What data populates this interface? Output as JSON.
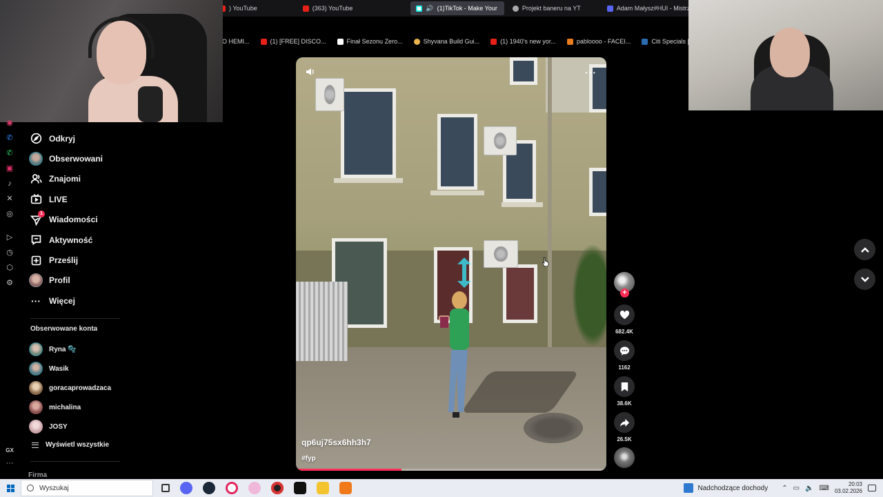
{
  "browser": {
    "tabs": [
      {
        "label": ") YouTube",
        "icon": "youtube-icon",
        "active": false
      },
      {
        "label": "(363) YouTube",
        "icon": "youtube-icon",
        "active": false
      },
      {
        "label": "(1)TikTok - Make Your",
        "icon": "tiktok-icon",
        "active": true
      },
      {
        "label": "Projekt baneru na YT",
        "icon": "globe-icon",
        "active": false
      },
      {
        "label": "Adam Małysz#HUI - Mistrz",
        "icon": "discord-icon",
        "active": false
      }
    ],
    "new_tab_glyph": "+",
    "bookmarks": [
      {
        "label": "O HEMI...",
        "icon": "none"
      },
      {
        "label": "(1) [FREE] DISCO...",
        "icon": "youtube-icon"
      },
      {
        "label": "Finał Sezonu Zero...",
        "icon": "f-icon"
      },
      {
        "label": "Shyvana Build Gui...",
        "icon": "lol-icon"
      },
      {
        "label": "(1) 1940's new yor...",
        "icon": "youtube-icon"
      },
      {
        "label": "pabloooo - FACEI...",
        "icon": "faceit-icon"
      },
      {
        "label": "Citi Specials | Sko...",
        "icon": "citi-icon"
      }
    ]
  },
  "sidebar": {
    "items": [
      {
        "label": "Odkryj",
        "icon": "compass-icon"
      },
      {
        "label": "Obserwowani",
        "icon": "avatar"
      },
      {
        "label": "Znajomi",
        "icon": "friends-icon"
      },
      {
        "label": "LIVE",
        "icon": "live-icon"
      },
      {
        "label": "Wiadomości",
        "icon": "send-icon",
        "badge": "1"
      },
      {
        "label": "Aktywność",
        "icon": "message-icon"
      },
      {
        "label": "Prześlij",
        "icon": "upload-icon"
      },
      {
        "label": "Profil",
        "icon": "avatar"
      },
      {
        "label": "Więcej",
        "icon": "more-icon"
      }
    ],
    "followed_title": "Obserwowane konta",
    "followed": [
      {
        "name": "Ryna 🫧",
        "color": "#6f8b7d"
      },
      {
        "name": "Wasik",
        "color": "#5a7d88"
      },
      {
        "name": "goracaprowadzaca",
        "color": "#8a6b4d"
      },
      {
        "name": "michalina",
        "color": "#8a4f4f"
      },
      {
        "name": "JOSY",
        "color": "#c9a3a8"
      }
    ],
    "show_all": "Wyświetl wszystkie",
    "company": "Firma"
  },
  "video": {
    "username": "qp6uj75sx6hh3h7",
    "hashtag": "#fyp",
    "progress": 0.34,
    "more_glyph": "···"
  },
  "actions": {
    "likes": "682.4K",
    "comments": "1162",
    "saves": "38.6K",
    "shares": "26.5K",
    "follow_glyph": "+"
  },
  "iconstrip": {
    "gx": "GX",
    "more": "···"
  },
  "taskbar": {
    "search_placeholder": "Wyszukaj",
    "news": "Nadchodzące dochody",
    "time": "20:03",
    "date": "03.02.2026"
  },
  "colors": {
    "accent": "#fe2c55",
    "background": "#000000"
  }
}
